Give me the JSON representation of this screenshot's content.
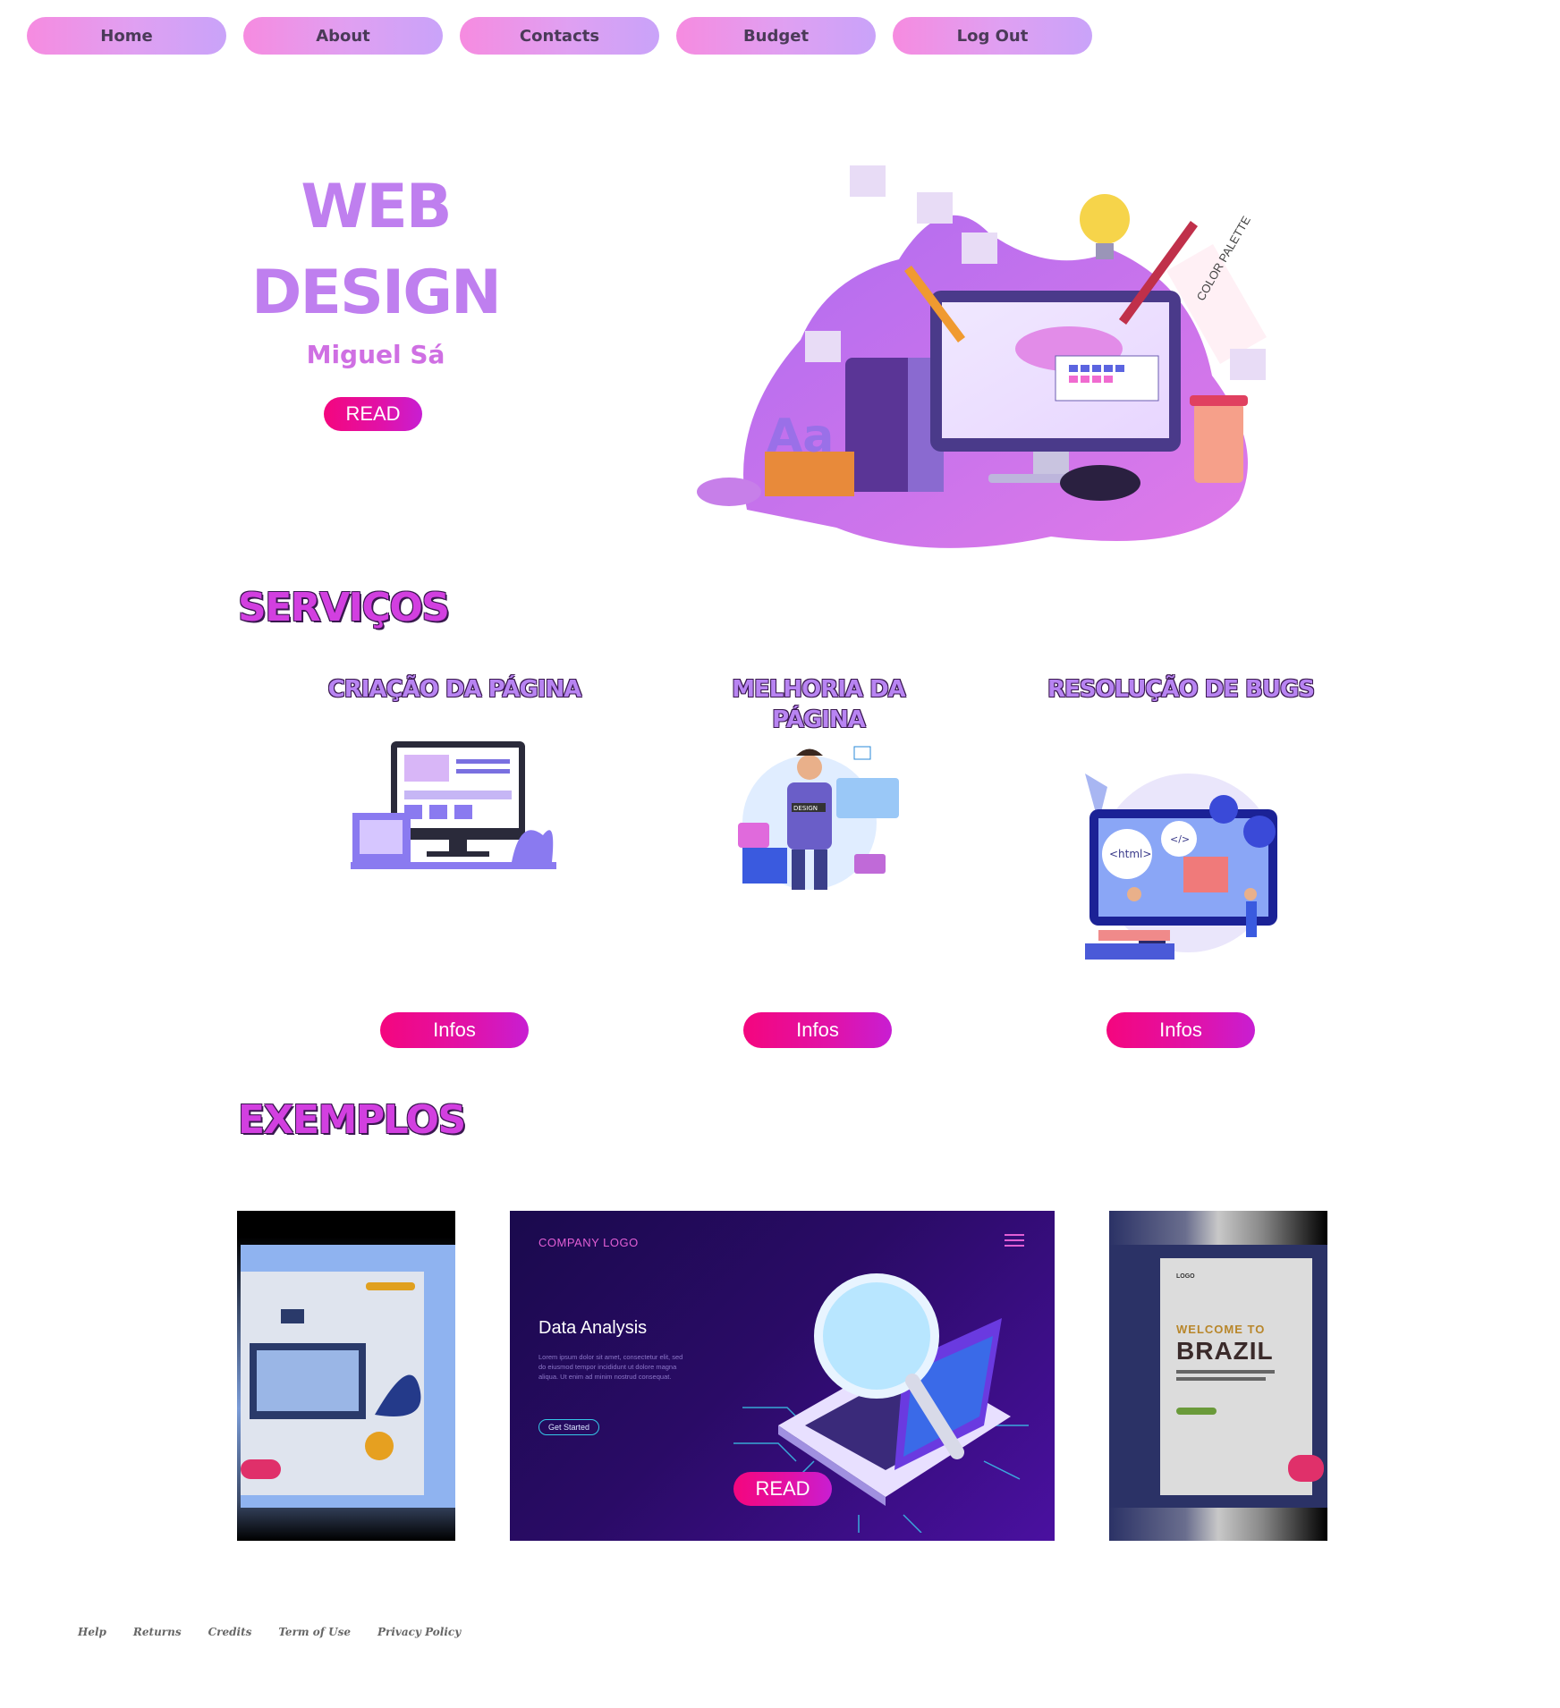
{
  "nav": {
    "items": [
      {
        "label": "Home"
      },
      {
        "label": "About"
      },
      {
        "label": "Contacts"
      },
      {
        "label": "Budget"
      },
      {
        "label": "Log Out"
      }
    ]
  },
  "hero": {
    "title_line1": "WEB",
    "title_line2": "DESIGN",
    "author": "Miguel Sá",
    "read_label": "READ",
    "art_labels": {
      "palette": "COLOR PALETTE",
      "letters": "Aa"
    }
  },
  "services": {
    "heading": "SERVIÇOS",
    "items": [
      {
        "title": "CRIAÇÃO DA PÁGINA",
        "button": "Infos"
      },
      {
        "title": "MELHORIA DA PÁGINA",
        "button": "Infos"
      },
      {
        "title": "RESOLUÇÃO DE BUGS",
        "button": "Infos",
        "art_labels": {
          "html": "<html>",
          "code": "</>"
        }
      }
    ],
    "design_badge": "DESIGN"
  },
  "examples": {
    "heading": "EXEMPLOS",
    "center": {
      "company_logo": "COMPANY LOGO",
      "title": "Data Analysis",
      "body": "Lorem ipsum dolor sit amet, consectetur elit, sed do eiusmod tempor incididunt ut dolore magna aliqua. Ut enim ad minim nostrud consequat.",
      "cta": "Get Started",
      "read_label": "READ"
    },
    "right": {
      "logo": "LOGO",
      "welcome": "WELCOME TO",
      "title": "BRAZIL"
    }
  },
  "footer": {
    "links": [
      "Help",
      "Returns",
      "Credits",
      "Term of Use",
      "Privacy Policy"
    ]
  },
  "colors": {
    "nav_gradient_start": "#f68be0",
    "nav_gradient_end": "#c9a3f9",
    "accent_pink": "#f4067e",
    "heading_purple": "#bf7fef",
    "section_magenta": "#d23fe0"
  }
}
